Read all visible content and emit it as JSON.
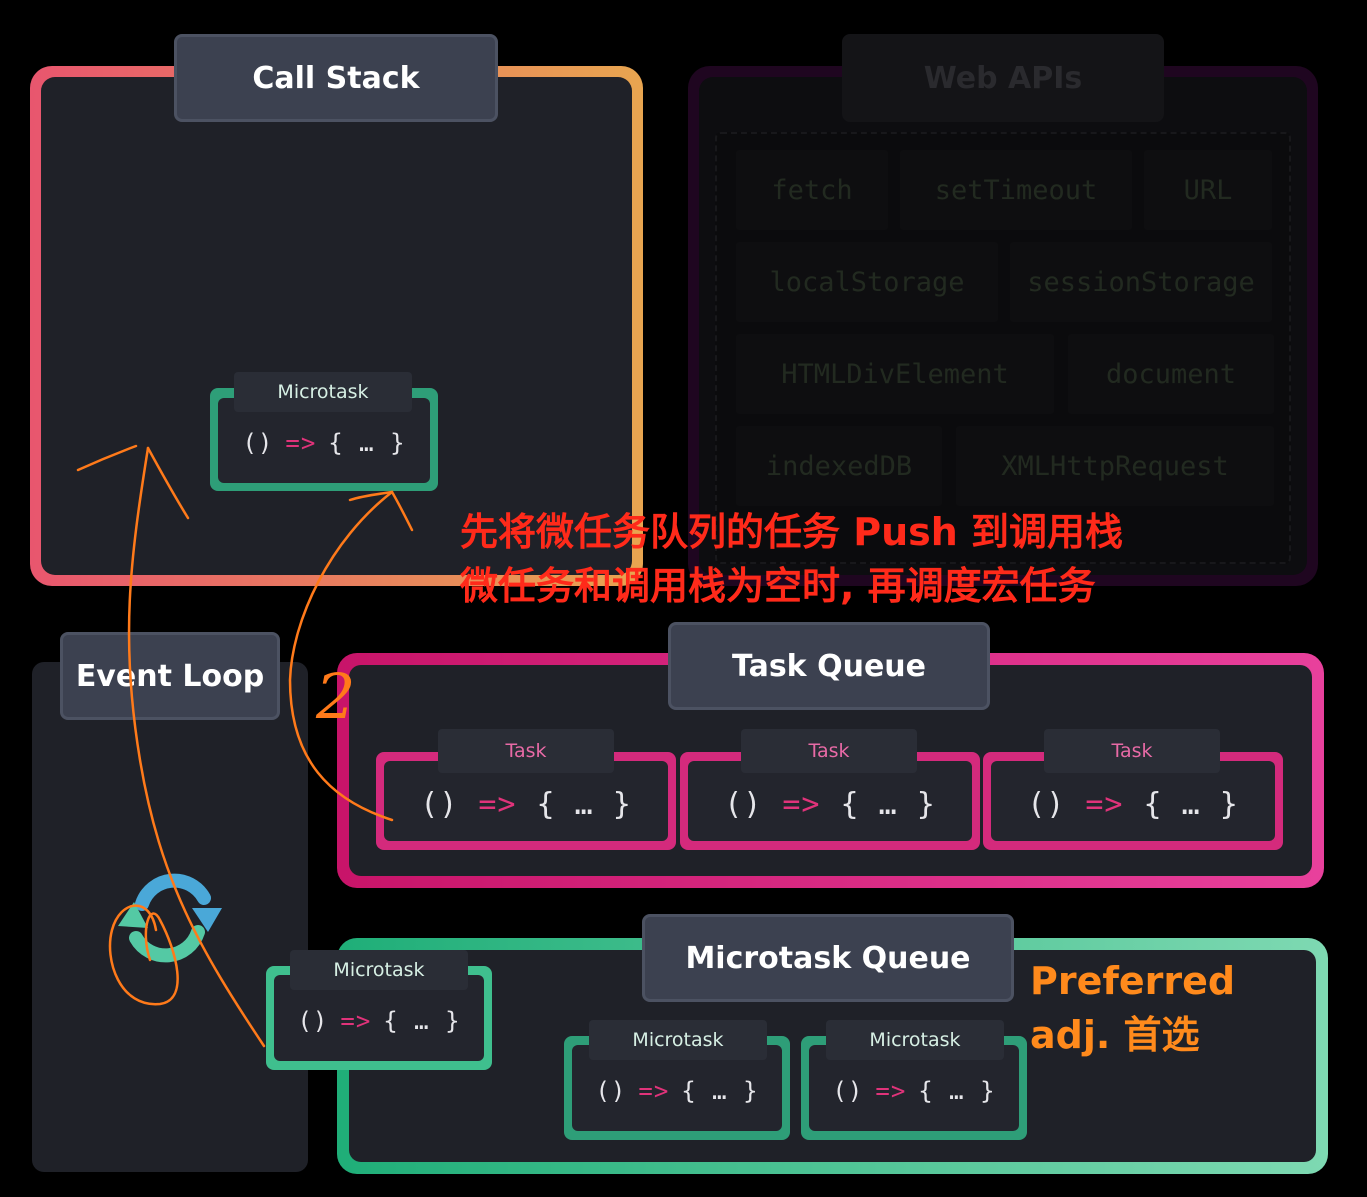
{
  "call_stack": {
    "title": "Call Stack",
    "microtask": {
      "label": "Microtask",
      "code_open": "()",
      "code_arrow": "=>",
      "code_body": "{ … }"
    }
  },
  "web_apis": {
    "title": "Web APIs",
    "items": [
      "fetch",
      "setTimeout",
      "URL",
      "localStorage",
      "sessionStorage",
      "HTMLDivElement",
      "document",
      "indexedDB",
      "XMLHttpRequest"
    ]
  },
  "event_loop": {
    "title": "Event Loop",
    "icon": "refresh-cycle-icon"
  },
  "task_queue": {
    "title": "Task Queue",
    "tasks": [
      {
        "label": "Task",
        "code_open": "()",
        "code_arrow": "=>",
        "code_body": "{ … }"
      },
      {
        "label": "Task",
        "code_open": "()",
        "code_arrow": "=>",
        "code_body": "{ … }"
      },
      {
        "label": "Task",
        "code_open": "()",
        "code_arrow": "=>",
        "code_body": "{ … }"
      }
    ]
  },
  "microtask_queue": {
    "title": "Microtask Queue",
    "outgoing": {
      "label": "Microtask",
      "code_open": "()",
      "code_arrow": "=>",
      "code_body": "{ … }"
    },
    "items": [
      {
        "label": "Microtask",
        "code_open": "()",
        "code_arrow": "=>",
        "code_body": "{ … }"
      },
      {
        "label": "Microtask",
        "code_open": "()",
        "code_arrow": "=>",
        "code_body": "{ … }"
      }
    ]
  },
  "annotations": {
    "red_line_1": "先将微任务队列的任务 Push 到调用栈",
    "red_line_2": "微任务和调用栈为空时, 再调度宏任务",
    "orange_line_1": "Preferred",
    "orange_line_2": "adj. 首选",
    "step_marker": "2"
  },
  "colors": {
    "call_stack_gradient": [
      "#e8566e",
      "#e8a550"
    ],
    "task_pink": "#e0337a",
    "microtask_green": "#3fbf8e",
    "annotation_red": "#ff2a1a",
    "annotation_orange": "#ff8a1c"
  }
}
